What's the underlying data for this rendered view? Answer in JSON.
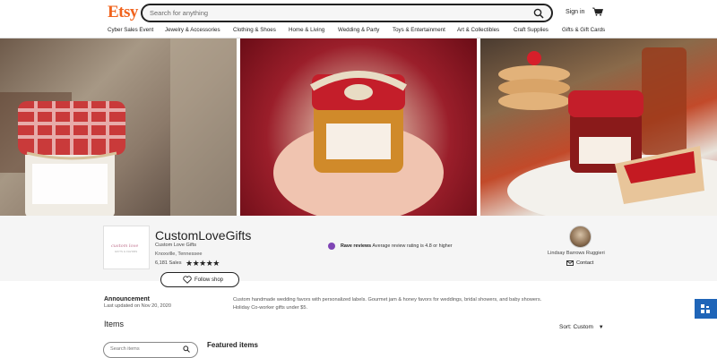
{
  "header": {
    "logo": "Etsy",
    "search_placeholder": "Search for anything",
    "sign_in": "Sign in"
  },
  "nav": {
    "items": [
      "Cyber Sales Event",
      "Jewelry & Accessories",
      "Clothing & Shoes",
      "Home & Living",
      "Wedding & Party",
      "Toys & Entertainment",
      "Art & Collectibles",
      "Craft Supplies",
      "Gifts & Gift Cards"
    ]
  },
  "banner": {
    "images": [
      "jam-jar-gingham",
      "jam-jar-hands",
      "jam-jar-toast"
    ]
  },
  "shop": {
    "logo_text": "custom love",
    "logo_subtext": "GIFTS & FAVORS",
    "name": "CustomLoveGifts",
    "subtitle": "Custom Love Gifts",
    "location": "Knoxville, Tennessee",
    "sales": "6,181 Sales",
    "rating_stars": "★★★★★",
    "follow_label": "Follow shop",
    "rave_title": "Rave reviews",
    "rave_text": "Average review rating is 4.8 or higher"
  },
  "owner": {
    "name": "Lindsay Barrows Ruggieri",
    "contact_label": "Contact"
  },
  "announcement": {
    "title": "Announcement",
    "updated": "Last updated on Nov 20, 2020",
    "text": "Custom handmade wedding favors with personalized labels. Gourmet jam & honey favors for weddings, bridal showers, and baby showers. Holiday Co-worker gifts under $5."
  },
  "items": {
    "title": "Items",
    "sort_label": "Sort: Custom",
    "search_placeholder": "Search items",
    "featured_title": "Featured items"
  },
  "colors": {
    "brand": "#f1641e",
    "rave": "#7f45b5",
    "feedback": "#1f65b8"
  }
}
